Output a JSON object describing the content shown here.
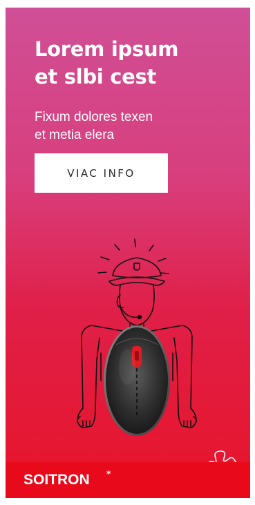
{
  "banner": {
    "headline_line1": "Lorem ipsum",
    "headline_line2": "et slbi cest",
    "subline_line1": "Fixum dolores texen",
    "subline_line2": "et metia elera",
    "cta_label": "VIAC INFO",
    "brand": "SOITRON",
    "brand_mark": "*"
  },
  "colors": {
    "gradient_top": "#d04f96",
    "gradient_bottom": "#e8142a",
    "footer_red": "#e8091a",
    "button_bg": "#ffffff",
    "button_text": "#2a2a2a"
  },
  "icons": {
    "illustration": "police-officer-line-drawing",
    "product": "wireless-mouse"
  }
}
